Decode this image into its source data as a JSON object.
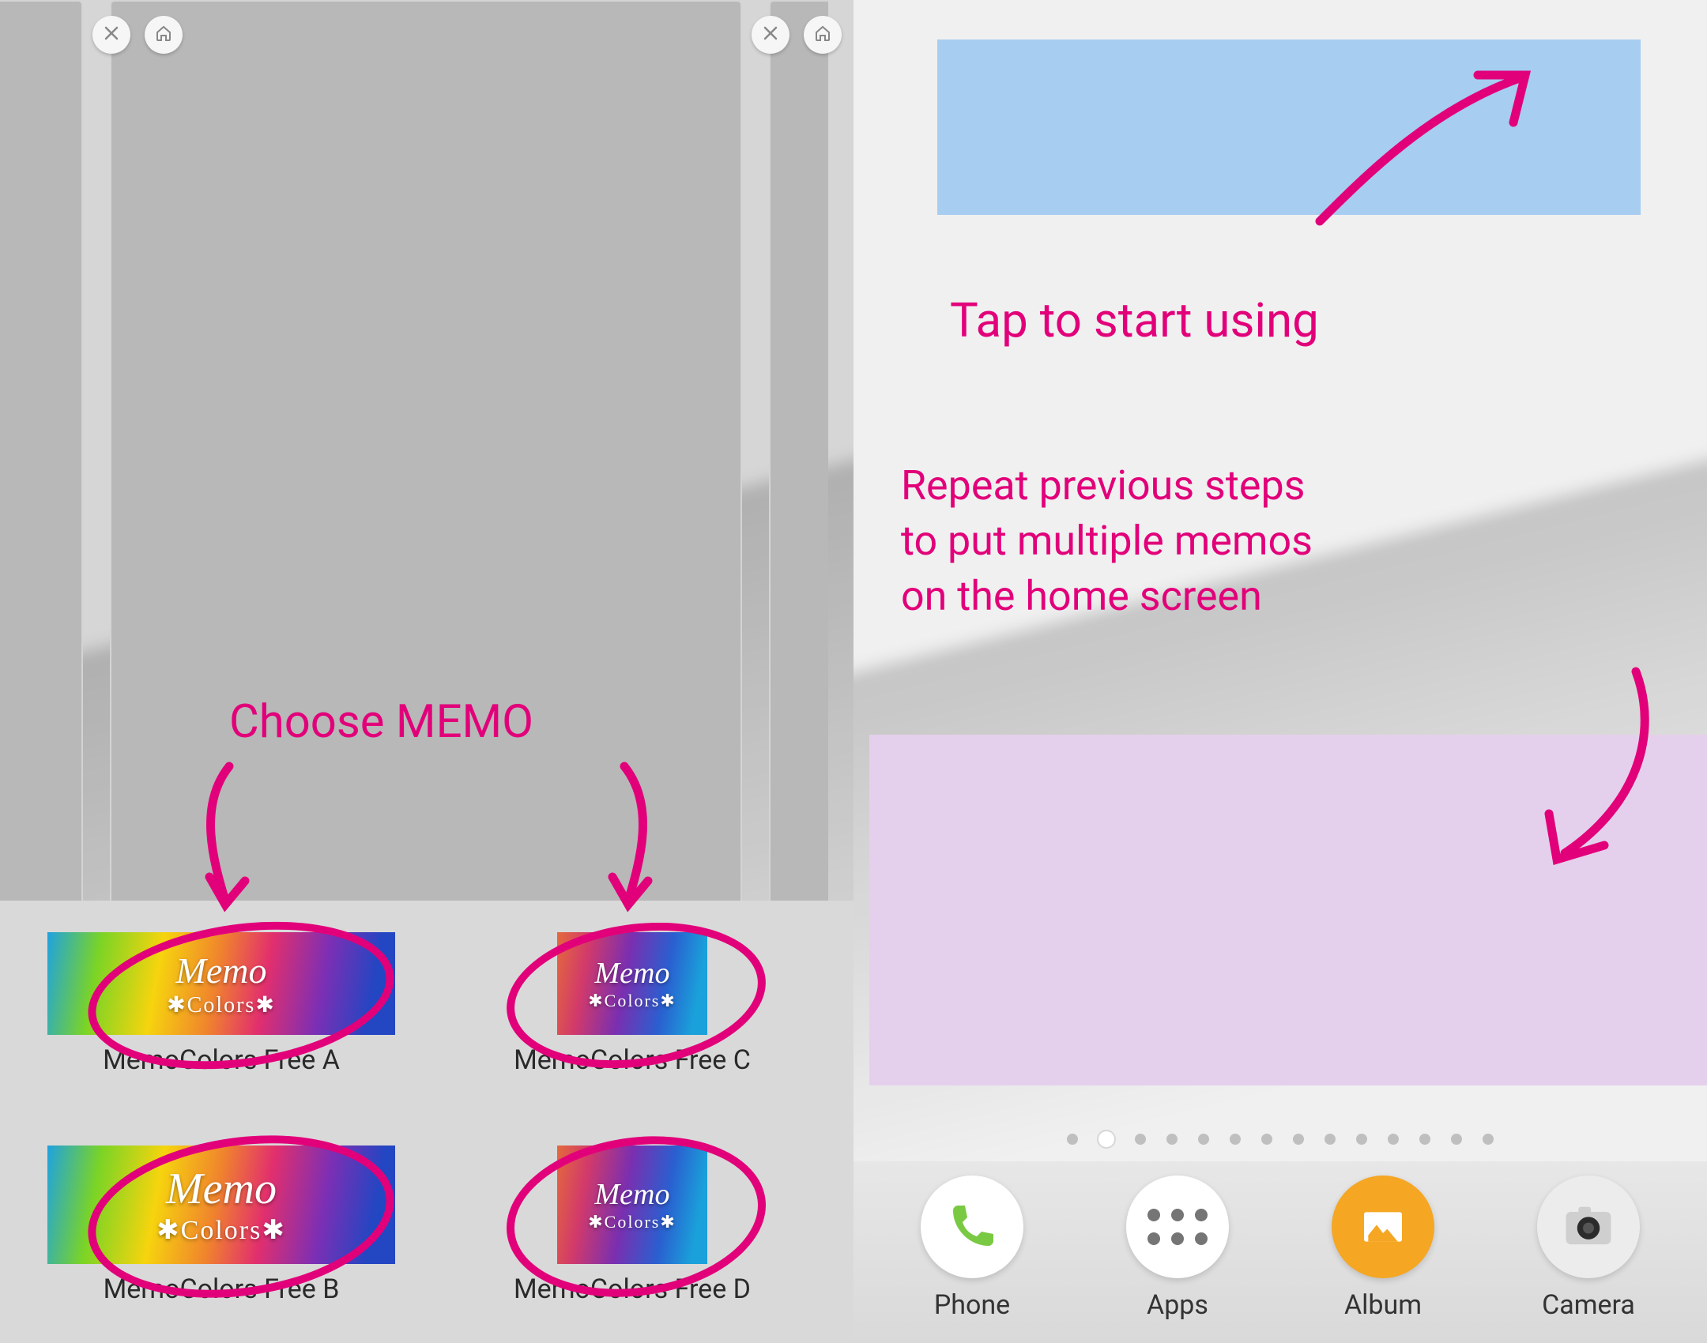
{
  "annotations": {
    "left_heading": "Choose MEMO",
    "right_tap": "Tap to start using",
    "right_repeat": "Repeat previous steps\nto put multiple memos\non the home screen"
  },
  "memo_badge": {
    "line1": "Memo",
    "line2": "✱Colors✱"
  },
  "widgets": [
    {
      "label": "MemoColors Free A",
      "shape": "wide"
    },
    {
      "label": "MemoColors Free C",
      "shape": "square"
    },
    {
      "label": "MemoColors Free B",
      "shape": "wide"
    },
    {
      "label": "MemoColors Free D",
      "shape": "square"
    }
  ],
  "dock": [
    {
      "label": "Phone"
    },
    {
      "label": "Apps"
    },
    {
      "label": "Album"
    },
    {
      "label": "Camera"
    }
  ],
  "page_dots": {
    "count": 14,
    "active_index": 1
  },
  "colors": {
    "accent": "#e2007a"
  }
}
